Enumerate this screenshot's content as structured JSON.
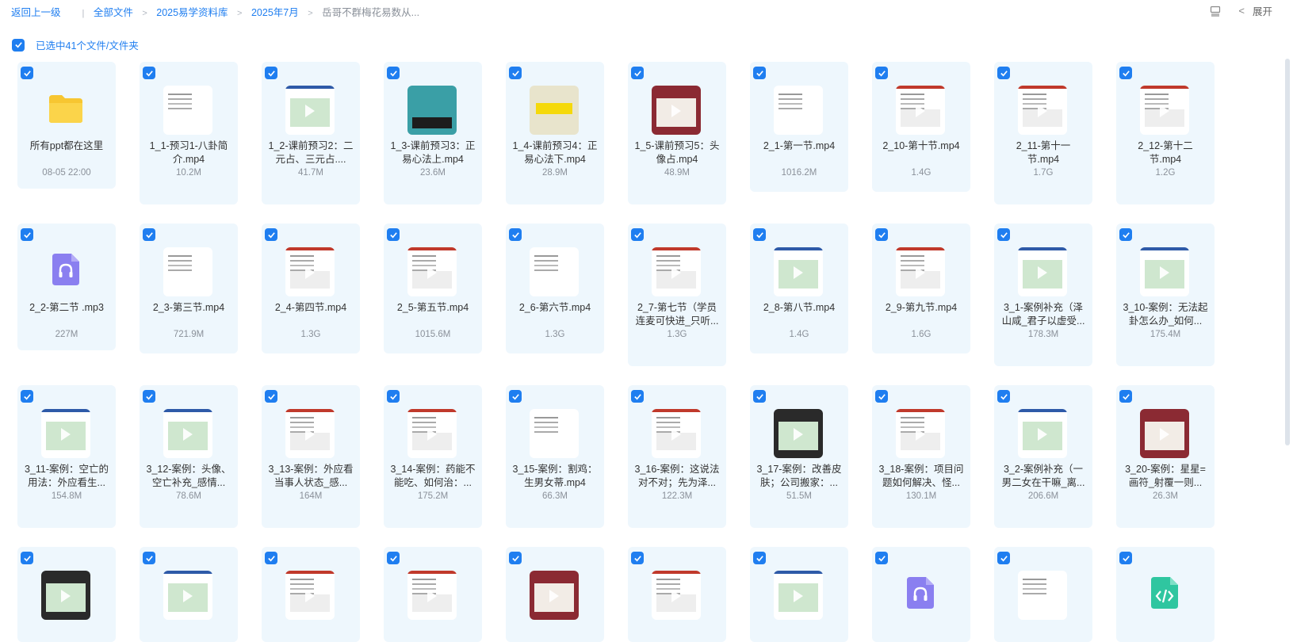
{
  "breadcrumb": {
    "back": "返回上一级",
    "items": [
      "全部文件",
      "2025易学资料库",
      "2025年7月"
    ],
    "current": "岳哥不群梅花易数从..."
  },
  "top_right": {
    "expand_label": "展开"
  },
  "selection": {
    "text": "已选中41个文件/文件夹"
  },
  "accent_color": "#1f7ef0",
  "files": [
    {
      "name": "所有ppt都在这里",
      "meta": "08-05 22:00",
      "kind": "folder"
    },
    {
      "name": "1_1-预习1-八卦简介.mp4",
      "meta": "10.2M",
      "kind": "video"
    },
    {
      "name": "1_2-课前预习2：二元占、三元占....",
      "meta": "41.7M",
      "kind": "video"
    },
    {
      "name": "1_3-课前预习3：正易心法上.mp4",
      "meta": "23.6M",
      "kind": "video"
    },
    {
      "name": "1_4-课前预习4：正易心法下.mp4",
      "meta": "28.9M",
      "kind": "video"
    },
    {
      "name": "1_5-课前预习5：头像占.mp4",
      "meta": "48.9M",
      "kind": "video"
    },
    {
      "name": "2_1-第一节.mp4",
      "meta": "1016.2M",
      "kind": "video"
    },
    {
      "name": "2_10-第十节.mp4",
      "meta": "1.4G",
      "kind": "video"
    },
    {
      "name": "2_11-第十一节.mp4",
      "meta": "1.7G",
      "kind": "video"
    },
    {
      "name": "2_12-第十二节.mp4",
      "meta": "1.2G",
      "kind": "video"
    },
    {
      "name": "2_2-第二节 .mp3",
      "meta": "227M",
      "kind": "audio"
    },
    {
      "name": "2_3-第三节.mp4",
      "meta": "721.9M",
      "kind": "video"
    },
    {
      "name": "2_4-第四节.mp4",
      "meta": "1.3G",
      "kind": "video"
    },
    {
      "name": "2_5-第五节.mp4",
      "meta": "1015.6M",
      "kind": "video"
    },
    {
      "name": "2_6-第六节.mp4",
      "meta": "1.3G",
      "kind": "video"
    },
    {
      "name": "2_7-第七节（学员连麦可快进_只听...",
      "meta": "1.3G",
      "kind": "video"
    },
    {
      "name": "2_8-第八节.mp4",
      "meta": "1.4G",
      "kind": "video"
    },
    {
      "name": "2_9-第九节.mp4",
      "meta": "1.6G",
      "kind": "video"
    },
    {
      "name": "3_1-案例补充（泽山咸_君子以虚受...",
      "meta": "178.3M",
      "kind": "video"
    },
    {
      "name": "3_10-案例：无法起卦怎么办_如何...",
      "meta": "175.4M",
      "kind": "video"
    },
    {
      "name": "3_11-案例：空亡的用法：外应看生...",
      "meta": "154.8M",
      "kind": "video"
    },
    {
      "name": "3_12-案例：头像、空亡补充_感情...",
      "meta": "78.6M",
      "kind": "video"
    },
    {
      "name": "3_13-案例：外应看当事人状态_感...",
      "meta": "164M",
      "kind": "video"
    },
    {
      "name": "3_14-案例：药能不能吃、如何治：...",
      "meta": "175.2M",
      "kind": "video"
    },
    {
      "name": "3_15-案例：割鸡：生男女蒂.mp4",
      "meta": "66.3M",
      "kind": "video"
    },
    {
      "name": "3_16-案例：这说法对不对；先为泽...",
      "meta": "122.3M",
      "kind": "video"
    },
    {
      "name": "3_17-案例：改善皮肤；公司搬家：...",
      "meta": "51.5M",
      "kind": "video"
    },
    {
      "name": "3_18-案例：项目问题如何解决、怪...",
      "meta": "130.1M",
      "kind": "video"
    },
    {
      "name": "3_2-案例补充（一男二女在干嘛_离...",
      "meta": "206.6M",
      "kind": "video"
    },
    {
      "name": "3_20-案例：星星=画符_射覆一则...",
      "meta": "26.3M",
      "kind": "video"
    },
    {
      "name": "",
      "meta": "",
      "kind": "video"
    },
    {
      "name": "",
      "meta": "",
      "kind": "video"
    },
    {
      "name": "",
      "meta": "",
      "kind": "video"
    },
    {
      "name": "",
      "meta": "",
      "kind": "video"
    },
    {
      "name": "",
      "meta": "",
      "kind": "video"
    },
    {
      "name": "",
      "meta": "",
      "kind": "video"
    },
    {
      "name": "",
      "meta": "",
      "kind": "video"
    },
    {
      "name": "",
      "meta": "",
      "kind": "audio"
    },
    {
      "name": "",
      "meta": "",
      "kind": "doc"
    },
    {
      "name": "",
      "meta": "",
      "kind": "code"
    }
  ]
}
